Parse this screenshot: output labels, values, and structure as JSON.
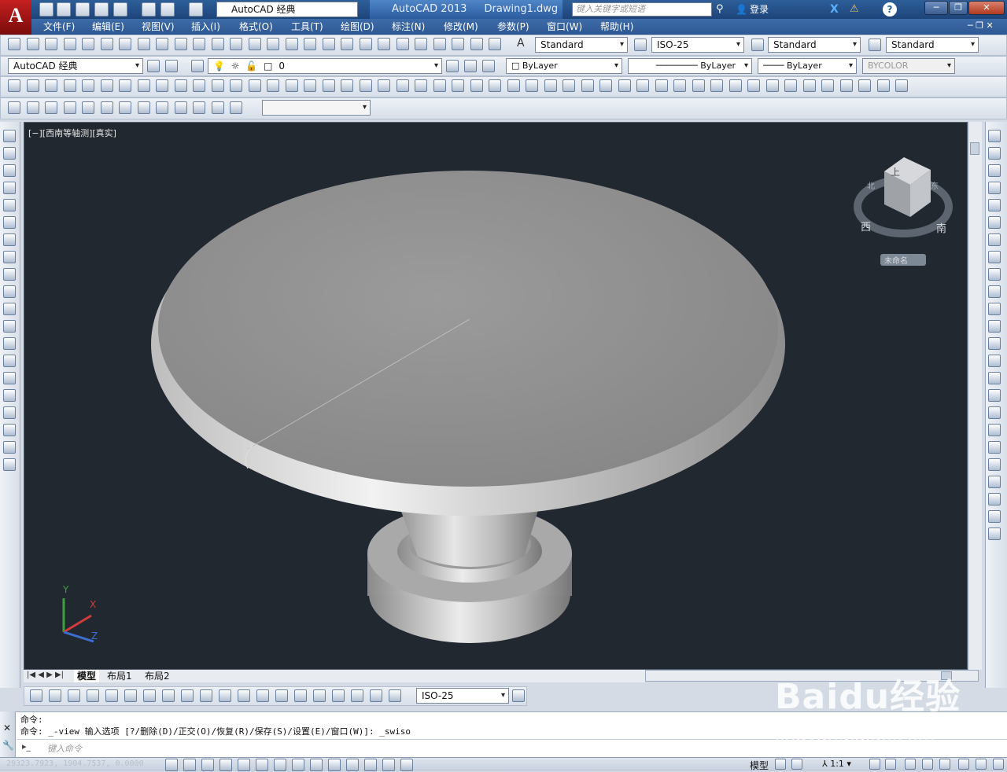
{
  "title_bar": {
    "workspace": "AutoCAD 经典",
    "app_title": "AutoCAD 2013",
    "doc_title": "Drawing1.dwg",
    "search_placeholder": "键入关键字或短语",
    "login_label": "登录"
  },
  "menu": [
    "文件(F)",
    "编辑(E)",
    "视图(V)",
    "插入(I)",
    "格式(O)",
    "工具(T)",
    "绘图(D)",
    "标注(N)",
    "修改(M)",
    "参数(P)",
    "窗口(W)",
    "帮助(H)"
  ],
  "styles_toolbar": {
    "text_style": "Standard",
    "dim_style": "ISO-25",
    "table_style": "Standard",
    "mleader_style": "Standard"
  },
  "layers_toolbar": {
    "workspace": "AutoCAD 经典",
    "current_layer": "0",
    "color": "ByLayer",
    "linetype": "ByLayer",
    "lineweight": "ByLayer",
    "plotstyle": "BYCOLOR"
  },
  "viewport": {
    "label": "[−][西南等轴测][真实]",
    "viewcube_top": "上",
    "viewcube_front": "南",
    "viewcube_left": "西",
    "viewcube_back": "北",
    "viewcube_right": "东",
    "ucs_menu": "未命名",
    "axis_x": "X",
    "axis_y": "Y",
    "axis_z": "Z"
  },
  "layout_tabs": [
    "模型",
    "布局1",
    "布局2"
  ],
  "dim_toolbar": {
    "dim_style": "ISO-25"
  },
  "command": {
    "line1": "命令:",
    "line2": "命令: _-view 输入选项 [?/删除(D)/正交(O)/恢复(R)/保存(S)/设置(E)/窗口(W)]: _swiso",
    "input_placeholder": "键入命令"
  },
  "status": {
    "coords": "29323.7923, 1904.7537, 0.0000",
    "model_label": "模型",
    "scale": "1:1"
  },
  "watermark": {
    "main": "Baidu经验",
    "sub": "jingyan.baidu.com"
  },
  "colors": {
    "viewport_bg": "#212830",
    "title_bar": "#2e5f99",
    "menu_bar": "#2e5892",
    "axis_x": "#d23b3b",
    "axis_y": "#3da03d",
    "axis_z": "#3d6fd1"
  }
}
